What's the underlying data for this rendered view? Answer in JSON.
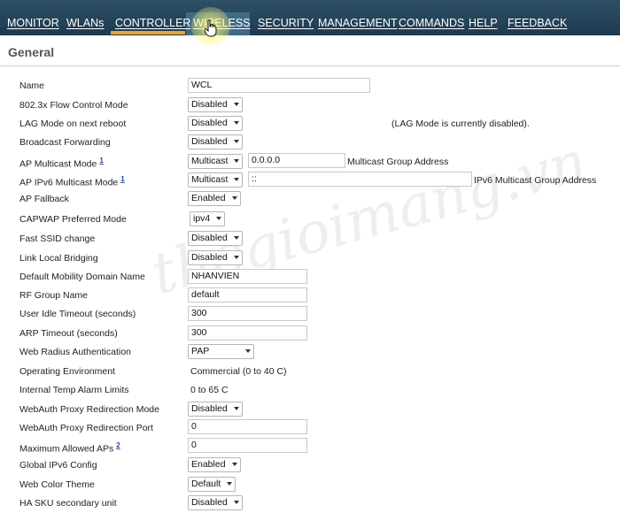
{
  "nav": {
    "tabs": [
      {
        "label": "MONITOR"
      },
      {
        "label": "WLANs"
      },
      {
        "label": "CONTROLLER"
      },
      {
        "label": "WIRELESS"
      },
      {
        "label": "SECURITY"
      },
      {
        "label": "MANAGEMENT"
      },
      {
        "label": "COMMANDS"
      },
      {
        "label": "HELP"
      },
      {
        "label": "FEEDBACK"
      }
    ],
    "active_tab": "CONTROLLER"
  },
  "page": {
    "title": "General"
  },
  "form": {
    "name": {
      "label": "Name",
      "value": "WCL"
    },
    "flow_control": {
      "label": "802.3x Flow Control Mode",
      "value": "Disabled"
    },
    "lag_mode": {
      "label": "LAG Mode on next reboot",
      "value": "Disabled",
      "note": "(LAG Mode is currently disabled)."
    },
    "broadcast_forwarding": {
      "label": "Broadcast Forwarding",
      "value": "Disabled"
    },
    "ap_multicast": {
      "label": "AP Multicast Mode",
      "footnote": "1",
      "mode": "Multicast",
      "address": "0.0.0.0",
      "address_label": "Multicast Group Address"
    },
    "ap_ipv6_multicast": {
      "label": "AP IPv6 Multicast Mode",
      "footnote": "1",
      "mode": "Multicast",
      "address": "::",
      "address_label": "IPv6 Multicast Group Address"
    },
    "ap_fallback": {
      "label": "AP Fallback",
      "value": "Enabled"
    },
    "capwap_mode": {
      "label": "CAPWAP Preferred Mode",
      "value": "ipv4"
    },
    "fast_ssid": {
      "label": "Fast SSID change",
      "value": "Disabled"
    },
    "link_local_bridging": {
      "label": "Link Local Bridging",
      "value": "Disabled"
    },
    "mobility_domain": {
      "label": "Default Mobility Domain Name",
      "value": "NHANVIEN"
    },
    "rf_group": {
      "label": "RF Group Name",
      "value": "default"
    },
    "user_idle_timeout": {
      "label": "User Idle Timeout (seconds)",
      "value": "300"
    },
    "arp_timeout": {
      "label": "ARP Timeout (seconds)",
      "value": "300"
    },
    "web_radius_auth": {
      "label": "Web Radius Authentication",
      "value": "PAP"
    },
    "operating_env": {
      "label": "Operating Environment",
      "value": "Commercial (0 to 40 C)"
    },
    "temp_alarm": {
      "label": "Internal Temp Alarm Limits",
      "value": "0 to 65 C"
    },
    "webauth_proxy_mode": {
      "label": "WebAuth Proxy Redirection Mode",
      "value": "Disabled"
    },
    "webauth_proxy_port": {
      "label": "WebAuth Proxy Redirection Port",
      "value": "0"
    },
    "max_aps": {
      "label": "Maximum Allowed APs",
      "footnote": "2",
      "value": "0"
    },
    "global_ipv6": {
      "label": "Global IPv6 Config",
      "value": "Enabled"
    },
    "web_color_theme": {
      "label": "Web Color Theme",
      "value": "Default"
    },
    "ha_sku": {
      "label": "HA SKU secondary unit",
      "value": "Disabled"
    }
  },
  "watermark": "thegioimang.vn",
  "colors": {
    "nav_bg": "#1e3a4f",
    "active_underline": "#e8a33a",
    "title": "#555555"
  }
}
